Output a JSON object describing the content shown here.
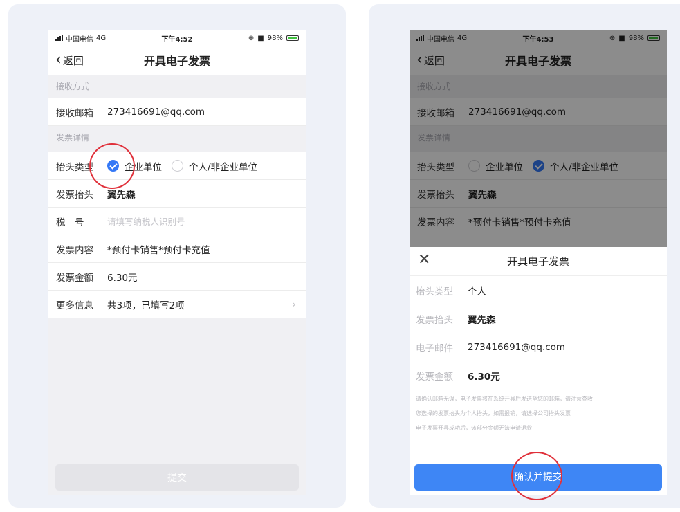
{
  "left": {
    "status": {
      "carrier": "中国电信",
      "network": "4G",
      "time": "下午4:52",
      "battery": "98%",
      "battery_level": 0.98
    },
    "nav": {
      "back_label": "返回",
      "title": "开具电子发票"
    },
    "sections": {
      "receive": "接收方式",
      "detail": "发票详情"
    },
    "email": {
      "label": "接收邮箱",
      "value": "273416691@qq.com"
    },
    "header_type": {
      "label": "抬头类型",
      "option1": "企业单位",
      "option2": "个人/非企业单位",
      "selected": "企业单位"
    },
    "invoice_header": {
      "label": "发票抬头",
      "value": "翼先森"
    },
    "tax": {
      "label": "税　号",
      "placeholder": "请填写纳税人识别号"
    },
    "content": {
      "label": "发票内容",
      "value": "*预付卡销售*预付卡充值"
    },
    "amount": {
      "label": "发票金额",
      "value": "6.30元"
    },
    "more": {
      "label": "更多信息",
      "value": "共3项，已填写2项",
      "arrow": "chevron-right-icon"
    },
    "submit_label": "提交"
  },
  "right": {
    "status": {
      "carrier": "中国电信",
      "network": "4G",
      "time": "下午4:53",
      "battery": "98%",
      "battery_level": 0.98
    },
    "nav": {
      "back_label": "返回",
      "title": "开具电子发票"
    },
    "sections": {
      "receive": "接收方式",
      "detail": "发票详情"
    },
    "email": {
      "label": "接收邮箱",
      "value": "273416691@qq.com"
    },
    "header_type": {
      "label": "抬头类型",
      "option1": "企业单位",
      "option2": "个人/非企业单位",
      "selected": "个人/非企业单位"
    },
    "invoice_header": {
      "label": "发票抬头",
      "value": "翼先森"
    },
    "content": {
      "label": "发票内容",
      "value": "*预付卡销售*预付卡充值"
    },
    "sheet": {
      "close_icon": "close-icon",
      "title": "开具电子发票",
      "rows": [
        {
          "label": "抬头类型",
          "value": "个人"
        },
        {
          "label": "发票抬头",
          "value": "翼先森"
        },
        {
          "label": "电子邮件",
          "value": "273416691@qq.com"
        },
        {
          "label": "发票金额",
          "value": "6.30元"
        }
      ],
      "notes": [
        "请确认邮箱无误，电子发票将在系统开具后发送至您的邮箱，请注意查收",
        "您选择的发票抬头为个人抬头，如需报销，请选择公司抬头发票",
        "电子发票开具成功后，该部分金额无法申请退款"
      ],
      "confirm_label": "确认并提交"
    }
  },
  "colors": {
    "accent": "#3e86f5",
    "highlight_ring": "#e0303a",
    "disabled_button": "#e4e4e8"
  }
}
